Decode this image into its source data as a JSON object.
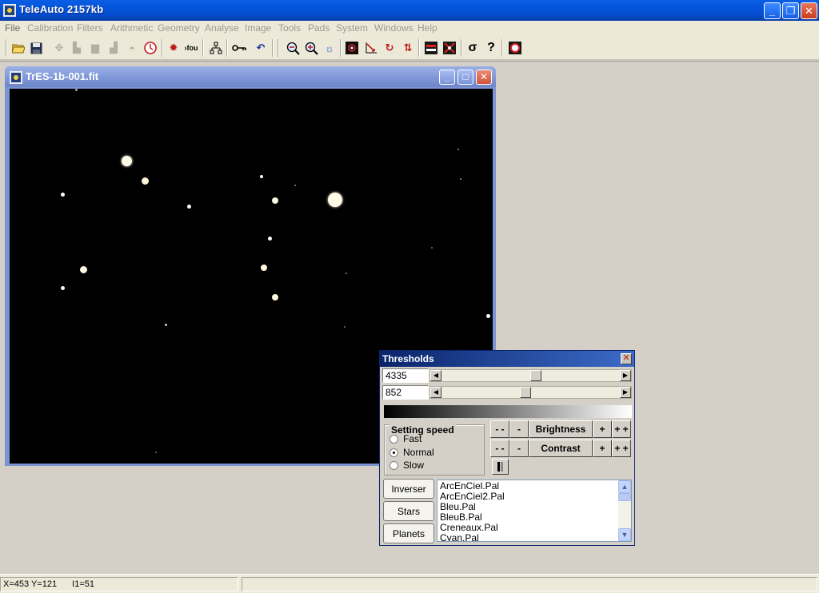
{
  "window": {
    "title": "TeleAuto 2157kb",
    "minimize": "_",
    "maximize": "❐",
    "close": "✕"
  },
  "menu": [
    {
      "label": "File",
      "enabled": true
    },
    {
      "label": "Calibration",
      "enabled": false
    },
    {
      "label": "Filters",
      "enabled": false
    },
    {
      "label": "Arithmetic",
      "enabled": false
    },
    {
      "label": "Geometry",
      "enabled": false
    },
    {
      "label": "Analyse",
      "enabled": false
    },
    {
      "label": "Image",
      "enabled": false
    },
    {
      "label": "Tools",
      "enabled": false
    },
    {
      "label": "Pads",
      "enabled": false
    },
    {
      "label": "System",
      "enabled": false
    },
    {
      "label": "Windows",
      "enabled": false
    },
    {
      "label": "Help",
      "enabled": false
    }
  ],
  "toolbar_icons": [
    "open-folder-icon",
    "save-icon",
    "move-icon",
    "crop-icon",
    "stack-icon",
    "align-icon",
    "dome-icon",
    "clock-icon",
    "star-red-icon",
    "script-icon",
    "network-icon",
    "key-icon",
    "undo-icon",
    "zoom-out-icon",
    "zoom-in-icon",
    "sun-icon",
    "star-find-icon",
    "curve-icon",
    "rotate-icon",
    "flip-icon",
    "histogram-icon",
    "noise-icon",
    "sigma-icon",
    "help-icon",
    "target-icon"
  ],
  "toolbar_glyphs": {
    "sigma": "σ",
    "help": "?",
    "scope": "›fou"
  },
  "image_window": {
    "title": "TrES-1b-001.fit",
    "minimize": "_",
    "maximize": "□",
    "close": "✕"
  },
  "thresholds": {
    "title": "Thresholds",
    "close": "✕",
    "high_value": "4335",
    "low_value": "852",
    "high_slider_fraction": 0.53,
    "low_slider_fraction": 0.47,
    "setting_speed": {
      "legend": "Setting speed",
      "options": [
        {
          "label": "Fast",
          "selected": false
        },
        {
          "label": "Normal",
          "selected": true
        },
        {
          "label": "Slow",
          "selected": false
        }
      ]
    },
    "brightness": {
      "label": "Brightness",
      "dec2": "- -",
      "dec1": "-",
      "inc1": "+",
      "inc2": "+ +"
    },
    "contrast": {
      "label": "Contrast",
      "dec2": "- -",
      "dec1": "-",
      "inc1": "+",
      "inc2": "+ +"
    },
    "buttons": {
      "inverser": "Inverser",
      "stars": "Stars",
      "planets": "Planets"
    },
    "palettes": [
      "ArcEnCiel.Pal",
      "ArcEnCiel2.Pal",
      "Bleu.Pal",
      "BleuB.Pal",
      "Creneaux.Pal",
      "Cyan.Pal"
    ]
  },
  "statusbar": {
    "coords": "X=453 Y=121",
    "intensity": "I1=51"
  }
}
